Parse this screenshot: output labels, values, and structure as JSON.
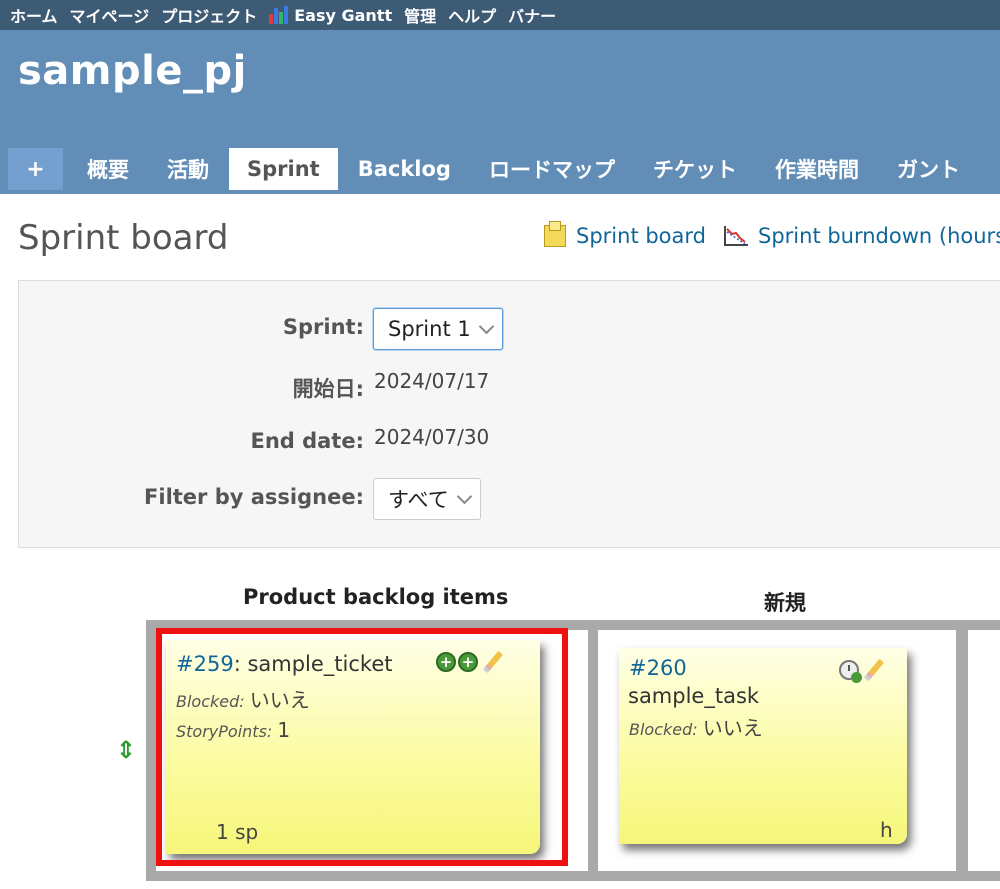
{
  "top_menu": {
    "items": [
      "ホーム",
      "マイページ",
      "プロジェクト",
      "Easy Gantt",
      "管理",
      "ヘルプ",
      "バナー"
    ]
  },
  "project": {
    "name": "sample_pj"
  },
  "tabs": [
    "+",
    "概要",
    "活動",
    "Sprint",
    "Backlog",
    "ロードマップ",
    "チケット",
    "作業時間",
    "ガント"
  ],
  "selected_tab": "Sprint",
  "page": {
    "heading": "Sprint board",
    "links": {
      "sprint_board": "Sprint board",
      "sprint_burndown": "Sprint burndown (hours)"
    }
  },
  "filters": {
    "sprint_label": "Sprint:",
    "sprint_value": "Sprint 1",
    "start_label": "開始日:",
    "start_value": "2024/07/17",
    "end_label": "End date:",
    "end_value": "2024/07/30",
    "assignee_label": "Filter by assignee:",
    "assignee_value": "すべて"
  },
  "board": {
    "columns": [
      "Product backlog items",
      "新規"
    ],
    "cards": [
      {
        "id": "#259",
        "subject": "sample_ticket",
        "blocked_label": "Blocked:",
        "blocked_value": "いいえ",
        "sp_label": "StoryPoints:",
        "sp_value": "1",
        "footer": "1 sp"
      },
      {
        "id": "#260",
        "subject": "sample_task",
        "blocked_label": "Blocked:",
        "blocked_value": "いいえ",
        "footer": "h"
      }
    ]
  },
  "colors": {
    "top_menu": "#3e5b76",
    "header": "#628db6",
    "highlight": "#ee1111",
    "link": "#116699"
  }
}
